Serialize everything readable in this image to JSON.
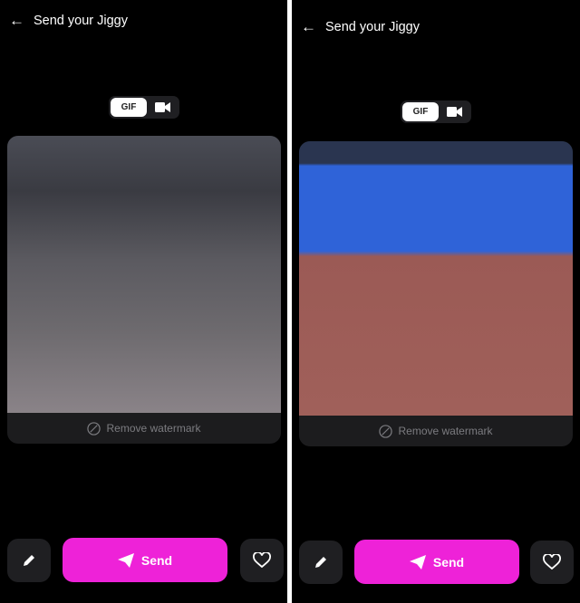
{
  "screens": [
    {
      "title": "Send your Jiggy",
      "format_toggle": {
        "gif_label": "GIF",
        "selected": "GIF",
        "video_icon": "video-camera-icon"
      },
      "watermark_label": "Remove watermark",
      "send_label": "Send"
    },
    {
      "title": "Send your Jiggy",
      "format_toggle": {
        "gif_label": "GIF",
        "selected": "GIF",
        "video_icon": "video-camera-icon"
      },
      "watermark_label": "Remove watermark",
      "send_label": "Send"
    }
  ],
  "colors": {
    "accent": "#ee22d8",
    "background": "#000000",
    "card": "#1c1c1e"
  }
}
